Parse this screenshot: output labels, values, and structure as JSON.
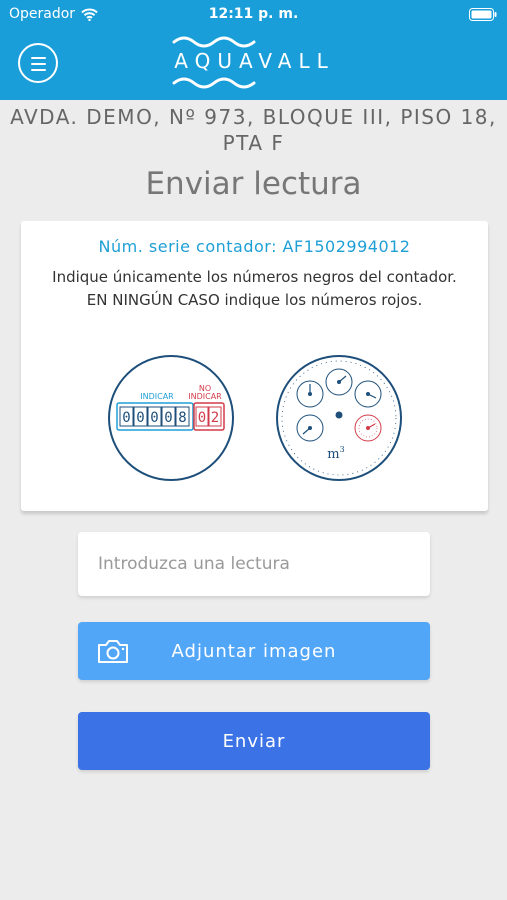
{
  "status_bar": {
    "carrier": "Operador",
    "time": "12:11 p. m."
  },
  "app": {
    "brand": "AQUAVALL",
    "accent": "#1a9ed9"
  },
  "address": "AVDA. DEMO, Nº 973, BLOQUE III, PISO 18, PTA F",
  "title": "Enviar lectura",
  "card": {
    "serial": "Núm. serie contador: AF1502994012",
    "instructions": "Indique únicamente los números negros del contador. EN NINGÚN CASO indique los números rojos.",
    "digital_meter": {
      "indicate_label": "INDICAR",
      "no_indicate_label_1": "NO",
      "no_indicate_label_2": "INDICAR",
      "black_digits": [
        "0",
        "0",
        "0",
        "0",
        "8"
      ],
      "red_digits": [
        "0",
        "2"
      ]
    },
    "analog_meter": {
      "unit": "m",
      "unit_exp": "3"
    }
  },
  "reading_input": {
    "placeholder": "Introduzca una lectura",
    "value": ""
  },
  "buttons": {
    "attach": "Adjuntar imagen",
    "send": "Enviar"
  }
}
